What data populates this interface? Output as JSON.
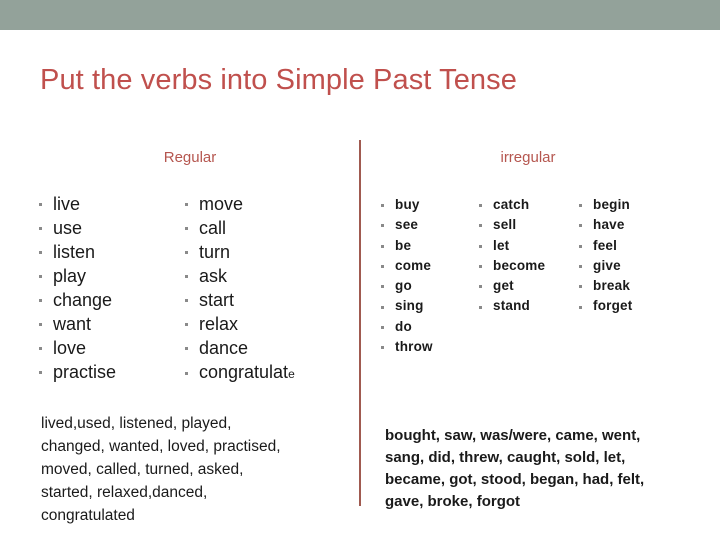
{
  "slide": {
    "title": "Put the verbs into Simple Past Tense",
    "accent_color": "#c0504d",
    "band_color": "#93a29a",
    "divider_color": "#a05a50"
  },
  "regular": {
    "heading": "Regular",
    "columns": [
      [
        "live",
        "use",
        "listen",
        "play",
        "change",
        "want",
        "love",
        "practise"
      ],
      [
        "move",
        "call",
        "turn",
        "ask",
        "start",
        "relax",
        "dance",
        "congratulat"
      ]
    ],
    "shrunk_tail": "e",
    "answers": "lived,used, listened, played,\nchanged, wanted, loved, practised,\nmoved, called,  turned, asked,\nstarted, relaxed,danced,\ncongratulated"
  },
  "irregular": {
    "heading": "irregular",
    "columns": [
      [
        "buy",
        "see",
        "be",
        "come",
        "go",
        "sing",
        "do",
        "throw"
      ],
      [
        "catch",
        "sell",
        "let",
        "become",
        "get",
        "stand"
      ],
      [
        "begin",
        "have",
        "feel",
        "give",
        "break",
        "forget"
      ]
    ],
    "answers": "bought, saw, was/were, came, went,\nsang, did, threw, caught, sold, let,\nbecame, got, stood, began, had, felt,\ngave, broke, forgot"
  }
}
